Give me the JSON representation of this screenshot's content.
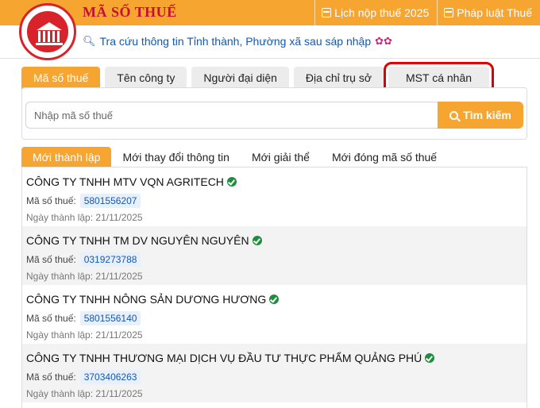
{
  "header": {
    "site_title": "MÃ SỐ THUẾ",
    "links": [
      {
        "label": "Lịch nộp thuế 2025",
        "icon": "calendar-icon"
      },
      {
        "label": "Pháp luật Thuế",
        "icon": "document-icon"
      }
    ],
    "notice": "Tra cứu thông tin Tỉnh thành, Phường xã sau sáp nhập",
    "colors": {
      "bar": "#f7a531",
      "title": "#c8102e",
      "notice": "#1557b0"
    }
  },
  "search": {
    "tabs": [
      {
        "label": "Mã số thuế",
        "active": true
      },
      {
        "label": "Tên công ty",
        "active": false
      },
      {
        "label": "Người đại diện",
        "active": false
      },
      {
        "label": "Địa chỉ trụ sở",
        "active": false
      },
      {
        "label": "MST cá nhân",
        "active": false,
        "highlighted": true
      }
    ],
    "placeholder": "Nhập mã số thuế",
    "value": "",
    "button_label": "Tìm kiếm"
  },
  "list": {
    "tabs": [
      {
        "label": "Mới thành lập",
        "active": true
      },
      {
        "label": "Mới thay đổi thông tin",
        "active": false
      },
      {
        "label": "Mới giải thể",
        "active": false
      },
      {
        "label": "Mới đóng mã số thuế",
        "active": false
      }
    ],
    "tax_label": "Mã số thuế:",
    "date_label": "Ngày thành lập:",
    "companies": [
      {
        "name": "CÔNG TY TNHH MTV VQN AGRITECH",
        "tax_id": "5801556207",
        "date": "21/11/2025",
        "verified": true
      },
      {
        "name": "CÔNG TY TNHH TM DV NGUYÊN NGUYÊN",
        "tax_id": "0319273788",
        "date": "21/11/2025",
        "verified": true
      },
      {
        "name": "CÔNG TY TNHH NÔNG SẢN DƯƠNG HƯƠNG",
        "tax_id": "5801556140",
        "date": "21/11/2025",
        "verified": true
      },
      {
        "name": "CÔNG TY TNHH THƯƠNG MẠI DỊCH VỤ ĐẦU TƯ THỰC PHẨM QUẢNG PHÚ",
        "tax_id": "3703406263",
        "date": "21/11/2025",
        "verified": true
      }
    ]
  }
}
